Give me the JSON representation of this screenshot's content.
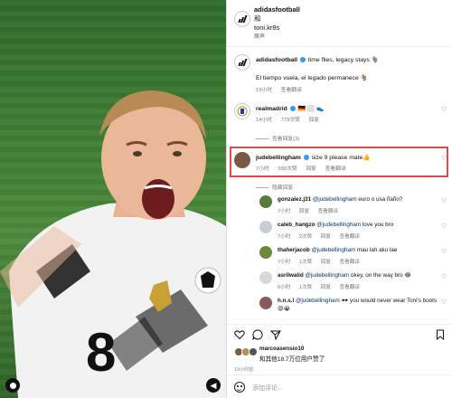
{
  "post_header": {
    "account": "adidasfootball",
    "conjunction": "和",
    "collaborator": "toni.kr8s",
    "audio": "原声"
  },
  "caption": {
    "username": "adidasfootball",
    "text_en": "time flies, legacy stays 🐐",
    "text_es": "El tiempo vuela, el legado permanece 🐐",
    "time": "19小时",
    "translate": "查看翻译"
  },
  "comments": [
    {
      "username": "realmadrid",
      "text": "🇩🇪 ⬜ 👟",
      "time": "14小时",
      "likes": "779次赞",
      "reply": "回复",
      "view_replies": "查看回复(3)"
    },
    {
      "username": "judebellingham",
      "text": "size 9 please mate👍",
      "time": "7小时",
      "likes": "930次赞",
      "reply": "回复",
      "translate": "查看翻译",
      "view_replies": "隐藏回复"
    }
  ],
  "replies": [
    {
      "username": "gonzalez.j31",
      "mention": "@judebellingham",
      "text": "euro o usa ñaño?",
      "time": "7小时",
      "likes": "",
      "reply": "回复",
      "translate": "查看翻译"
    },
    {
      "username": "caleb_hangzo",
      "mention": "@judebellingham",
      "text": "love you bro",
      "time": "7小时",
      "likes": "2次赞",
      "reply": "回复",
      "translate": "查看翻译"
    },
    {
      "username": "thaherjacob",
      "mention": "@judebellingham",
      "text": "mau lah aku lae",
      "time": "7小时",
      "likes": "1次赞",
      "reply": "回复",
      "translate": "查看翻译"
    },
    {
      "username": "asrilwalid",
      "mention": "@judebellingham",
      "text": "okey, on the way bro 😂",
      "time": "6小时",
      "likes": "1次赞",
      "reply": "回复",
      "translate": "查看翻译"
    },
    {
      "username": "h.n.s.i",
      "mention": "@judebellingham",
      "text": "🕶️ you would never wear Toni's boots 😩😭",
      "time": "7小时",
      "likes": "3次赞",
      "reply": "回复",
      "translate": "查看翻译"
    }
  ],
  "likes_section": {
    "liker": "marcoasensio10",
    "summary": "和其他18.7万位用户赞了",
    "date": "19小时前"
  },
  "comment_input": {
    "placeholder": "添加评论..."
  },
  "colors": {
    "highlight": "#e04a4a",
    "verified": "#3897f0",
    "mention": "#00376b"
  }
}
